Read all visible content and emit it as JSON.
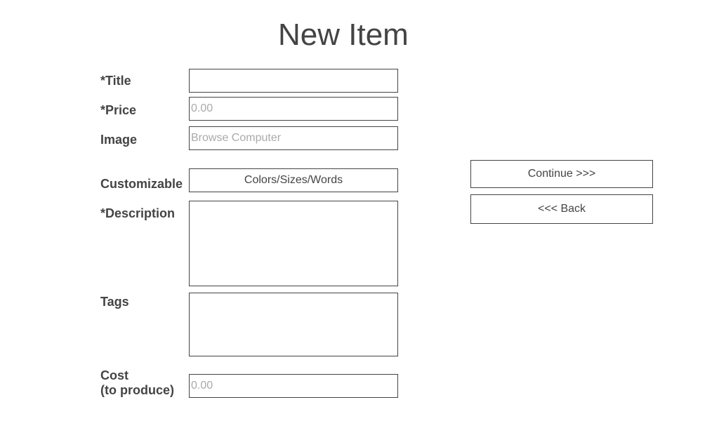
{
  "header": {
    "title": "New Item"
  },
  "form": {
    "title": {
      "label": "*Title",
      "value": ""
    },
    "price": {
      "label": "*Price",
      "placeholder": "0.00"
    },
    "image": {
      "label": "Image",
      "browse_text": "Browse Computer"
    },
    "customizable": {
      "label": "Customizable",
      "button_label": "Colors/Sizes/Words"
    },
    "description": {
      "label": "*Description",
      "value": ""
    },
    "tags": {
      "label": "Tags",
      "value": ""
    },
    "cost": {
      "label_line1": "Cost",
      "label_line2": "(to produce)",
      "placeholder": "0.00"
    }
  },
  "actions": {
    "continue_label": "Continue >>>",
    "back_label": "<<< Back"
  }
}
